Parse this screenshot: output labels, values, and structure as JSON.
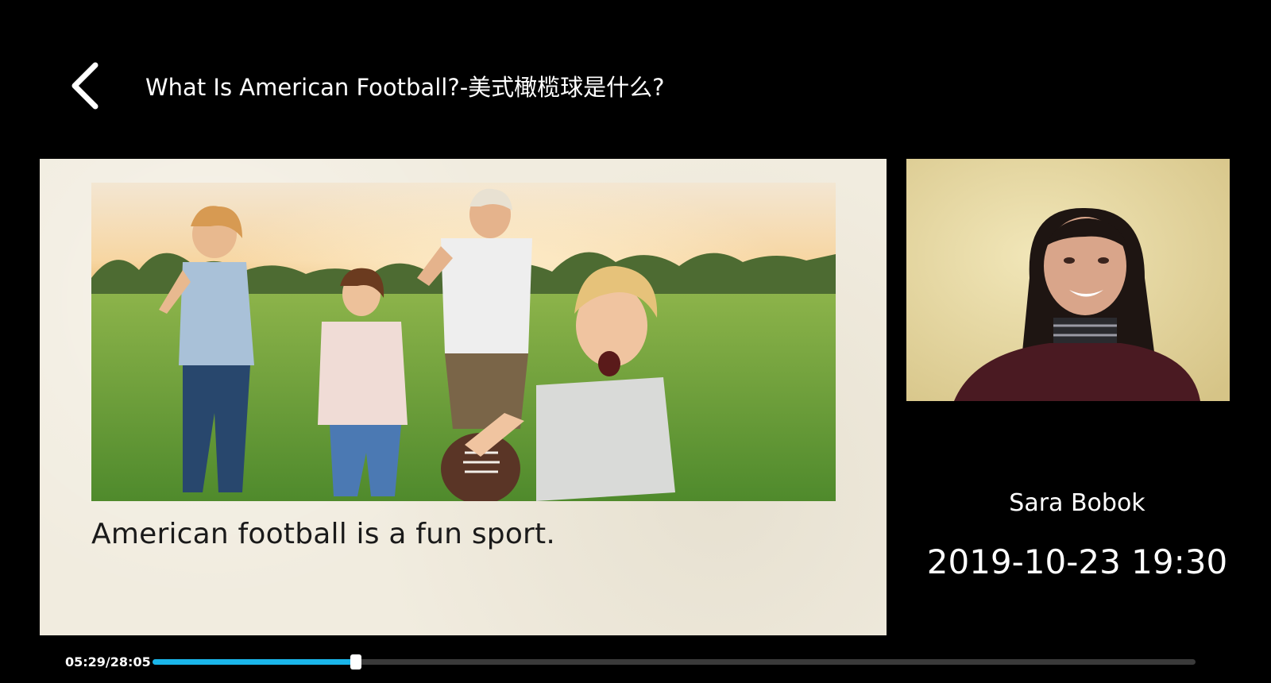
{
  "header": {
    "title": "What Is American Football?-美式橄榄球是什么?",
    "back_icon": "chevron-left-icon"
  },
  "slide": {
    "caption": "American football is a fun sport.",
    "photo_icon": "family-running-with-football-photo"
  },
  "teacher": {
    "name": "Sara Bobok",
    "session_datetime": "2019-10-23 19:30"
  },
  "playback": {
    "time_readout": "05:29/28:05",
    "progress_fraction": 0.1953
  },
  "colors": {
    "background": "#000000",
    "accent": "#1ab6ea",
    "slide_paper": "#f1ecdf"
  }
}
